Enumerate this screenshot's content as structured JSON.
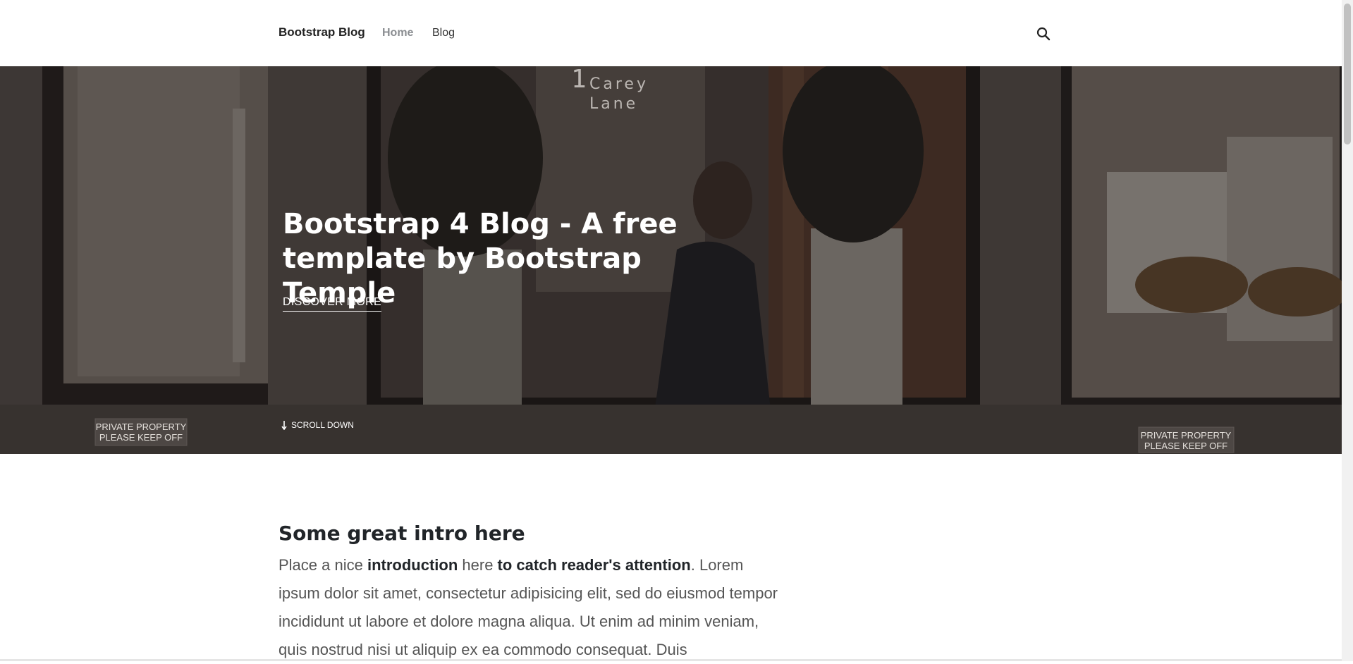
{
  "navbar": {
    "brand": "Bootstrap Blog",
    "links": [
      {
        "label": "Home",
        "active": true
      },
      {
        "label": "Blog",
        "active": false
      }
    ],
    "search_icon": "search-icon"
  },
  "hero": {
    "title": "Bootstrap 4 Blog - A free template by Bootstrap Temple",
    "cta_label": "DISCOVER MORE",
    "scroll_label": "SCROLL DOWN",
    "scroll_icon": "arrow-down-icon",
    "sign_left": "PRIVATE PROPERTY\nPLEASE KEEP OFF",
    "sign_right": "PRIVATE PROPERTY\nPLEASE KEEP OFF",
    "window_text": "Carey\nLane",
    "window_number": "1"
  },
  "intro": {
    "title": "Some great intro here",
    "p1": "Place a nice ",
    "b1": "introduction",
    "p2": " here ",
    "b2": "to catch reader's attention",
    "p3": ". Lorem ipsum dolor sit amet, consectetur adipisicing elit, sed do eiusmod tempor incididunt ut labore et dolore magna aliqua. Ut enim ad minim veniam, quis nostrud nisi ut aliquip ex ea commodo consequat. Duis"
  },
  "colors": {
    "nav_active": "#8a8d91",
    "hero_overlay": "#2b2624"
  }
}
